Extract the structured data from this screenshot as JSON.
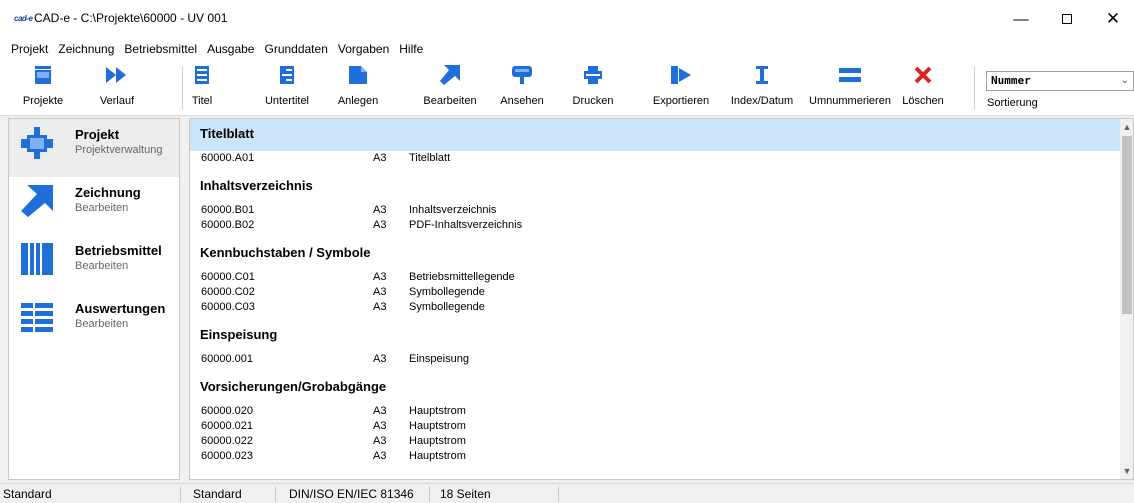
{
  "window": {
    "title": "CAD-e - C:\\Projekte\\60000 - UV 001",
    "logo": "cad-e",
    "controls": {
      "minimize": "—",
      "close": "✕"
    }
  },
  "menu": [
    "Projekt",
    "Zeichnung",
    "Betriebsmittel",
    "Ausgabe",
    "Grunddaten",
    "Vorgaben",
    "Hilfe"
  ],
  "toolbar": {
    "buttons": [
      {
        "label": "Projekte",
        "icon": "projects-icon"
      },
      {
        "label": "Verlauf",
        "icon": "history-forward-icon"
      },
      {
        "label": "Titel",
        "icon": "title-page-icon"
      },
      {
        "label": "Untertitel",
        "icon": "subtitle-page-icon"
      },
      {
        "label": "Anlegen",
        "icon": "new-drawing-icon"
      },
      {
        "label": "Bearbeiten",
        "icon": "edit-arrow-icon"
      },
      {
        "label": "Ansehen",
        "icon": "view-icon"
      },
      {
        "label": "Drucken",
        "icon": "printer-icon"
      },
      {
        "label": "Exportieren",
        "icon": "export-icon"
      },
      {
        "label": "Index/Datum",
        "icon": "index-cursor-icon"
      },
      {
        "label": "Umnummerieren",
        "icon": "renumber-icon"
      },
      {
        "label": "Löschen",
        "icon": "delete-x-icon"
      }
    ],
    "sort": {
      "value": "Nummer",
      "label": "Sortierung"
    }
  },
  "sidebar": {
    "items": [
      {
        "title": "Projekt",
        "subtitle": "Projektverwaltung",
        "icon": "project-icon",
        "active": true
      },
      {
        "title": "Zeichnung",
        "subtitle": "Bearbeiten",
        "icon": "drawing-arrow-icon",
        "active": false
      },
      {
        "title": "Betriebsmittel",
        "subtitle": "Bearbeiten",
        "icon": "equipment-icon",
        "active": false
      },
      {
        "title": "Auswertungen",
        "subtitle": "Bearbeiten",
        "icon": "reports-icon",
        "active": false
      }
    ]
  },
  "document_groups": [
    {
      "heading": "Titelblatt",
      "selected": true,
      "rows": [
        {
          "number": "60000.A01",
          "format": "A3",
          "title": "Titelblatt"
        }
      ]
    },
    {
      "heading": "Inhaltsverzeichnis",
      "selected": false,
      "rows": [
        {
          "number": "60000.B01",
          "format": "A3",
          "title": "Inhaltsverzeichnis"
        },
        {
          "number": "60000.B02",
          "format": "A3",
          "title": "PDF-Inhaltsverzeichnis"
        }
      ]
    },
    {
      "heading": "Kennbuchstaben / Symbole",
      "selected": false,
      "rows": [
        {
          "number": "60000.C01",
          "format": "A3",
          "title": "Betriebsmittellegende"
        },
        {
          "number": "60000.C02",
          "format": "A3",
          "title": "Symbollegende"
        },
        {
          "number": "60000.C03",
          "format": "A3",
          "title": "Symbollegende"
        }
      ]
    },
    {
      "heading": "Einspeisung",
      "selected": false,
      "rows": [
        {
          "number": "60000.001",
          "format": "A3",
          "title": "Einspeisung"
        }
      ]
    },
    {
      "heading": "Vorsicherungen/Grobabgänge",
      "selected": false,
      "rows": [
        {
          "number": "60000.020",
          "format": "A3",
          "title": "Hauptstrom"
        },
        {
          "number": "60000.021",
          "format": "A3",
          "title": "Hauptstrom"
        },
        {
          "number": "60000.022",
          "format": "A3",
          "title": "Hauptstrom"
        },
        {
          "number": "60000.023",
          "format": "A3",
          "title": "Hauptstrom"
        }
      ]
    }
  ],
  "statusbar": {
    "left": "Standard",
    "mid": "Standard",
    "norm": "DIN/ISO EN/IEC 81346",
    "pages": "18 Seiten"
  },
  "colors": {
    "accent": "#1e6fd9",
    "delete": "#e02020",
    "selection": "#cce4f7"
  }
}
